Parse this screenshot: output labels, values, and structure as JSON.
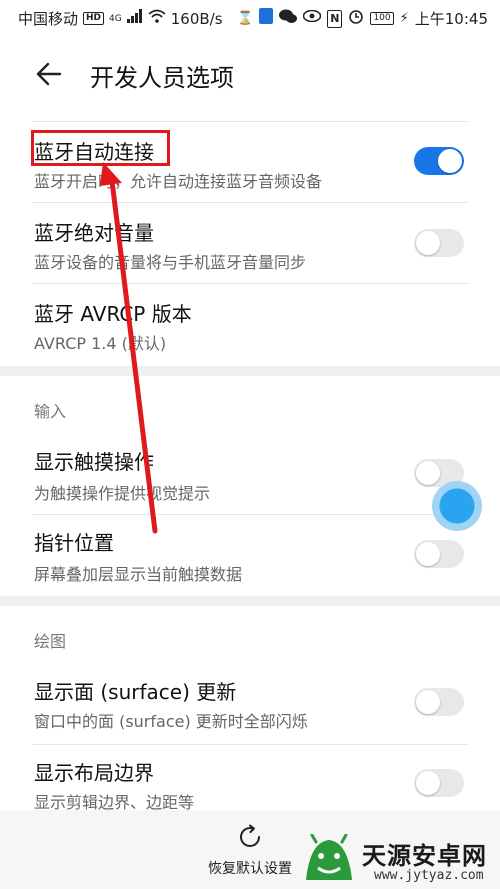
{
  "status_bar": {
    "carrier": "中国移动",
    "network": "4G",
    "speed": "160B/s",
    "battery": "100",
    "time": "上午10:45"
  },
  "header": {
    "title": "开发人员选项"
  },
  "settings": [
    {
      "title": "蓝牙自动连接",
      "subtitle": "蓝牙开启时，允许自动连接蓝牙音频设备",
      "toggle": true
    },
    {
      "title": "蓝牙绝对音量",
      "subtitle": "蓝牙设备的音量将与手机蓝牙音量同步",
      "toggle": false
    },
    {
      "title": "蓝牙 AVRCP 版本",
      "subtitle": "AVRCP 1.4 (默认)"
    },
    {
      "title": "显示触摸操作",
      "subtitle": "为触摸操作提供视觉提示",
      "toggle": false
    },
    {
      "title": "指针位置",
      "subtitle": "屏幕叠加层显示当前触摸数据",
      "toggle": false
    },
    {
      "title": "显示面 (surface) 更新",
      "subtitle": "窗口中的面 (surface) 更新时全部闪烁",
      "toggle": false
    },
    {
      "title": "显示布局边界",
      "subtitle": "显示剪辑边界、边距等",
      "toggle": false
    }
  ],
  "sections": {
    "input": "输入",
    "drawing": "绘图"
  },
  "bottom_bar": {
    "restore_label": "恢复默认设置"
  },
  "watermark": {
    "name": "天源安卓网",
    "url": "www.jytyaz.com"
  },
  "colors": {
    "toggle_on": "#1976e6",
    "highlight": "#e0191c",
    "touch_indicator": "#2aa3f0"
  }
}
